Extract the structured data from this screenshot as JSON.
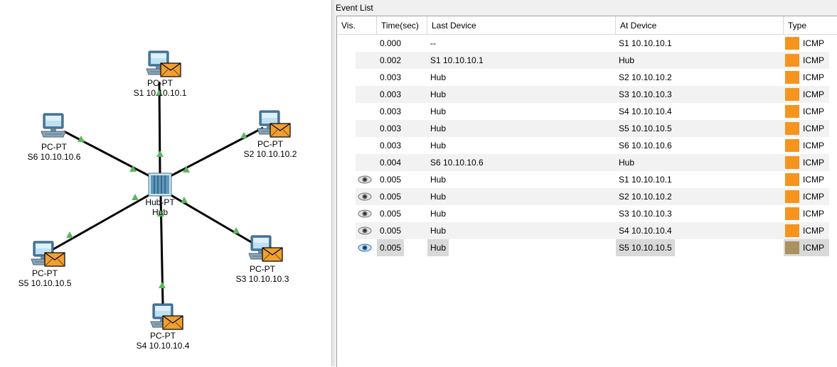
{
  "workspace": {
    "hub": {
      "type": "Hub-PT",
      "name": "Hub"
    },
    "pcs": [
      {
        "id": "s1",
        "type": "PC-PT",
        "name": "S1 10.10.10.1",
        "has_envelope": true
      },
      {
        "id": "s2",
        "type": "PC-PT",
        "name": "S2 10.10.10.2",
        "has_envelope": true
      },
      {
        "id": "s3",
        "type": "PC-PT",
        "name": "S3 10.10.10.3",
        "has_envelope": true
      },
      {
        "id": "s4",
        "type": "PC-PT",
        "name": "S4 10.10.10.4",
        "has_envelope": true
      },
      {
        "id": "s5",
        "type": "PC-PT",
        "name": "S5 10.10.10.5",
        "has_envelope": true
      },
      {
        "id": "s6",
        "type": "PC-PT",
        "name": "S6 10.10.10.6",
        "has_envelope": false
      }
    ],
    "link_status_color": "#5cb85c",
    "envelope_color": "#f0a030"
  },
  "event_list": {
    "title": "Event List",
    "columns": [
      "Vis.",
      "Time(sec)",
      "Last Device",
      "At Device",
      "Type"
    ],
    "rows": [
      {
        "vis": "",
        "time": "0.000",
        "last": "--",
        "at": "S1 10.10.10.1",
        "type": "ICMP",
        "color": "#f7941d"
      },
      {
        "vis": "",
        "time": "0.002",
        "last": "S1 10.10.10.1",
        "at": "Hub",
        "type": "ICMP",
        "color": "#f7941d"
      },
      {
        "vis": "",
        "time": "0.003",
        "last": "Hub",
        "at": "S2 10.10.10.2",
        "type": "ICMP",
        "color": "#f7941d"
      },
      {
        "vis": "",
        "time": "0.003",
        "last": "Hub",
        "at": "S3 10.10.10.3",
        "type": "ICMP",
        "color": "#f7941d"
      },
      {
        "vis": "",
        "time": "0.003",
        "last": "Hub",
        "at": "S4 10.10.10.4",
        "type": "ICMP",
        "color": "#f7941d"
      },
      {
        "vis": "",
        "time": "0.003",
        "last": "Hub",
        "at": "S5 10.10.10.5",
        "type": "ICMP",
        "color": "#f7941d"
      },
      {
        "vis": "",
        "time": "0.003",
        "last": "Hub",
        "at": "S6 10.10.10.6",
        "type": "ICMP",
        "color": "#f7941d"
      },
      {
        "vis": "",
        "time": "0.004",
        "last": "S6 10.10.10.6",
        "at": "Hub",
        "type": "ICMP",
        "color": "#f7941d"
      },
      {
        "vis": "eye-icon",
        "time": "0.005",
        "last": "Hub",
        "at": "S1 10.10.10.1",
        "type": "ICMP",
        "color": "#f7941d"
      },
      {
        "vis": "eye-icon",
        "time": "0.005",
        "last": "Hub",
        "at": "S2 10.10.10.2",
        "type": "ICMP",
        "color": "#f7941d"
      },
      {
        "vis": "eye-icon",
        "time": "0.005",
        "last": "Hub",
        "at": "S3 10.10.10.3",
        "type": "ICMP",
        "color": "#f7941d"
      },
      {
        "vis": "eye-icon",
        "time": "0.005",
        "last": "Hub",
        "at": "S4 10.10.10.4",
        "type": "ICMP",
        "color": "#f7941d"
      },
      {
        "vis": "eye-icon-current",
        "time": "0.005",
        "last": "Hub",
        "at": "S5 10.10.10.5",
        "type": "ICMP",
        "color": "#ab9060",
        "selected": true
      }
    ]
  }
}
